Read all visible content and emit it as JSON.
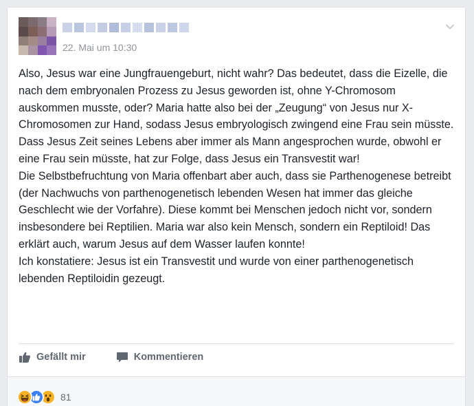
{
  "post": {
    "date": "22. Mai um 10:30",
    "paragraphs": [
      "Also, Jesus war eine Jungfrauengeburt, nicht wahr? Das bedeutet, dass die Eizelle, die nach dem embryonalen Prozess zu Jesus geworden ist, ohne Y-Chromosom auskommen musste, oder? Maria hatte also bei der „Zeugung“ von Jesus nur X-Chromosomen zur Hand, sodass Jesus embryologisch zwingend eine Frau sein müsste. Dass Jesus Zeit seines Lebens aber immer als Mann angesprochen wurde, obwohl er eine Frau sein müsste, hat zur Folge, dass Jesus ein Transvestit war!",
      "Die Selbstbefruchtung von Maria offenbart aber auch, dass sie Parthenogenese betreibt (der Nachwuchs von parthenogenetisch lebenden Wesen hat immer das gleiche Geschlecht wie der Vorfahre). Diese kommt bei Menschen jedoch nicht vor, sondern insbesondere bei Reptilien. Maria war also kein Mensch, sondern ein Reptiloid! Das erklärt auch, warum Jesus auf dem Wasser laufen konnte!",
      "Ich konstatiere: Jesus ist ein Transvestit und wurde von einer parthenogenetisch lebenden Reptiloidin gezeugt."
    ]
  },
  "actions": {
    "like_label": "Gefällt mir",
    "comment_label": "Kommentieren"
  },
  "reactions": {
    "types": [
      "haha",
      "like",
      "wow"
    ],
    "count": "81"
  },
  "colors": {
    "date": "#90949c",
    "action": "#606770",
    "like_blue": "#3b80f4",
    "emoji_yellow": "#f7b125"
  }
}
